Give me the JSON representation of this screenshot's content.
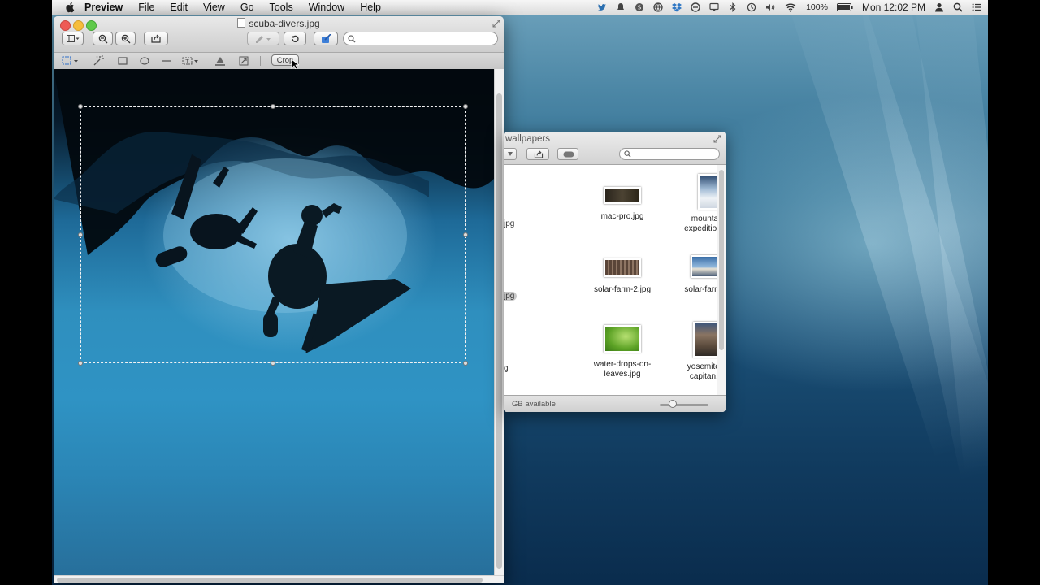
{
  "menubar": {
    "app_name": "Preview",
    "items": [
      "File",
      "Edit",
      "View",
      "Go",
      "Tools",
      "Window",
      "Help"
    ],
    "battery": "100%",
    "clock": "Mon 12:02 PM"
  },
  "preview": {
    "title": "scuba-divers.jpg",
    "markup": {
      "crop_label": "Crop"
    },
    "search_placeholder": ""
  },
  "finder": {
    "title_visible": "wallpapers",
    "status_visible": "GB available",
    "cut_labels": [
      "jpg",
      "jpg",
      "g"
    ],
    "items": [
      {
        "label": "mac-pro.jpg",
        "thumb_color": "#3a3428"
      },
      {
        "label": "mountain-\nexpedition.jpg",
        "thumb_color": "#6f8fb1"
      },
      {
        "label": "solar-farm-2.jpg",
        "thumb_color": "#7a5e4a"
      },
      {
        "label": "solar-farm.jpg",
        "thumb_color": "#6a8fb8"
      },
      {
        "label": "water-drops-on-\nleaves.jpg",
        "thumb_color": "#6cae35"
      },
      {
        "label": "yosemite-el-\ncapitan.jpg",
        "thumb_color": "#5b4a3b"
      }
    ]
  }
}
